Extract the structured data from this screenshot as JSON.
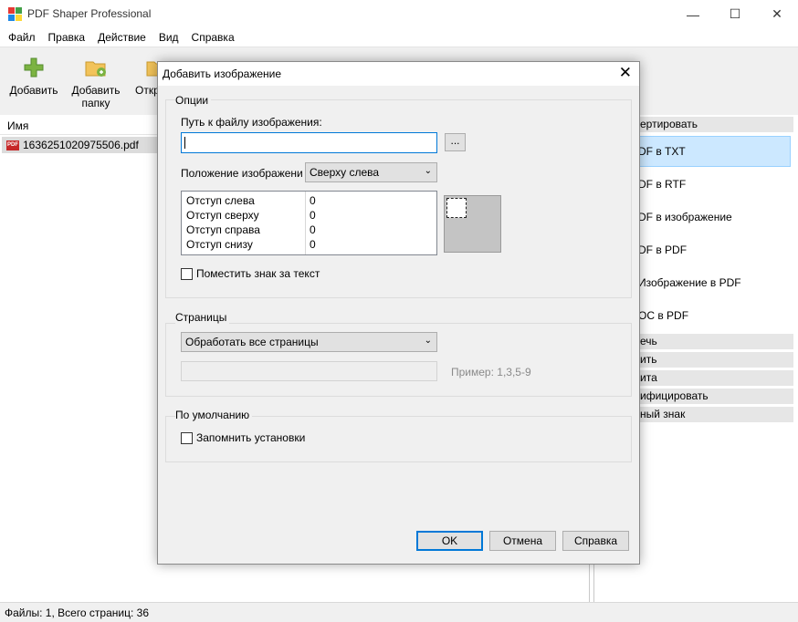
{
  "window": {
    "title": "PDF Shaper Professional",
    "minimize": "—",
    "maximize": "☐",
    "close": "✕"
  },
  "menu": [
    "Файл",
    "Правка",
    "Действие",
    "Вид",
    "Справка"
  ],
  "toolbar": {
    "add_label": "Добавить",
    "add_folder_label": "Добавить папку",
    "open_label": "Откр"
  },
  "filelist": {
    "column_name": "Имя",
    "files": [
      "1636251020975506.pdf"
    ],
    "pdf_badge": "PDF"
  },
  "right_panel": {
    "section_convert": "ертировать",
    "items": [
      "DF в TXT",
      "DF в RTF",
      "DF в изображение",
      "DF в PDF",
      "Изображение в PDF",
      "OC в PDF"
    ],
    "sections": [
      "ечь",
      "ить",
      "ита",
      "ифицировать",
      "ный знак"
    ]
  },
  "status": "Файлы: 1, Всего страниц: 36",
  "dialog": {
    "title": "Добавить изображение",
    "close": "✕",
    "options_group": "Опции",
    "path_label": "Путь к файлу изображения:",
    "path_value": "",
    "browse_label": "...",
    "position_label": "Положение изображени",
    "position_value": "Сверху слева",
    "offsets": [
      {
        "name": "Отступ слева",
        "value": "0"
      },
      {
        "name": "Отступ сверху",
        "value": "0"
      },
      {
        "name": "Отступ справа",
        "value": "0"
      },
      {
        "name": "Отступ снизу",
        "value": "0"
      }
    ],
    "behind_text_label": "Поместить знак за текст",
    "pages_group": "Страницы",
    "pages_value": "Обработать все страницы",
    "pages_range_value": "",
    "pages_example": "Пример: 1,3,5-9",
    "defaults_group": "По умолчанию",
    "remember_label": "Запомнить установки",
    "ok_label": "OK",
    "cancel_label": "Отмена",
    "help_label": "Справка"
  }
}
